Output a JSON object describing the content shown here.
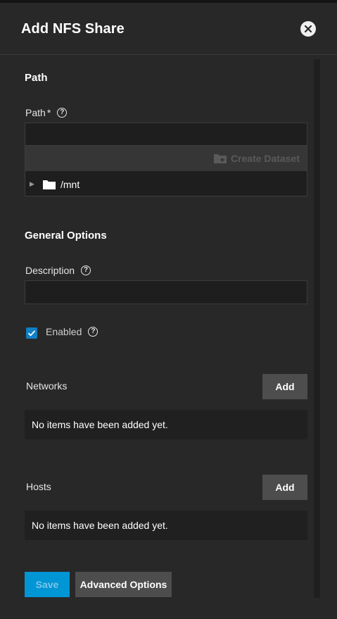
{
  "header": {
    "title": "Add NFS Share"
  },
  "path_section": {
    "title": "Path",
    "path_label": "Path",
    "required_mark": "*",
    "path_value": "",
    "create_dataset_label": "Create Dataset",
    "tree_root": "/mnt"
  },
  "general_section": {
    "title": "General Options",
    "description_label": "Description",
    "description_value": "",
    "enabled_label": "Enabled",
    "enabled_checked": true
  },
  "networks": {
    "label": "Networks",
    "add_label": "Add",
    "empty_text": "No items have been added yet."
  },
  "hosts": {
    "label": "Hosts",
    "add_label": "Add",
    "empty_text": "No items have been added yet."
  },
  "footer": {
    "save_label": "Save",
    "advanced_label": "Advanced Options"
  },
  "icons": {
    "close": "close-icon",
    "help": "help-icon",
    "folder_plus": "folder-plus-icon",
    "folder": "folder-icon",
    "expand": "chevron-right-icon",
    "check": "check-icon"
  },
  "colors": {
    "accent": "#0095d5",
    "checkbox": "#0f7fc6",
    "panel_bg": "#282828"
  }
}
